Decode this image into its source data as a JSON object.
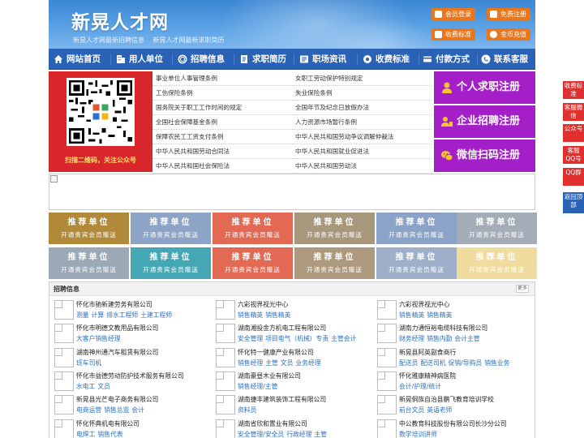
{
  "header": {
    "logo": "新晃人才网",
    "slogans": [
      "新晃人才网最新招聘信息",
      "新晃人才网最新求职简历"
    ],
    "buttons": {
      "member_login": "会员登录",
      "free_register": "免费注册",
      "fee_standard": "收费标准",
      "coin_recharge": "金币充值"
    }
  },
  "nav": [
    {
      "label": "网站首页",
      "icon": "home-icon"
    },
    {
      "label": "用人单位",
      "icon": "building-icon"
    },
    {
      "label": "招聘信息",
      "icon": "broadcast-icon"
    },
    {
      "label": "求职简历",
      "icon": "resume-icon"
    },
    {
      "label": "职场资讯",
      "icon": "news-icon"
    },
    {
      "label": "收费标准",
      "icon": "settings-icon"
    },
    {
      "label": "付款方式",
      "icon": "card-icon"
    },
    {
      "label": "联系客服",
      "icon": "phone-icon"
    }
  ],
  "qr": {
    "caption": "扫描二维码，关注公众号"
  },
  "links": {
    "left": [
      "事业单位人事管理条例",
      "工伤保险条例",
      "国务院关于职工工作时间的规定",
      "全国社会保障基金条例",
      "保障农民工工资支付条例",
      "中华人民共和国劳动合同法",
      "中华人民共和国社会保险法"
    ],
    "right": [
      "女职工劳动保护特别规定",
      "失业保险条例",
      "全国年节及纪念日放假办法",
      "人力资源市场暂行条例",
      "中华人民共和国劳动争议调解仲裁法",
      "中华人民共和国就业促进法",
      "中华人民共和国劳动法"
    ]
  },
  "register": [
    {
      "label": "个人求职注册",
      "icon": "person-icon"
    },
    {
      "label": "企业招聘注册",
      "icon": "company-icon"
    },
    {
      "label": "微信扫码注册",
      "icon": "wechat-icon"
    }
  ],
  "recommend": {
    "title": "推荐单位",
    "subtitle": "开通贵宾会员赠送",
    "colors": [
      "#b08a3a",
      "#8ea4c6",
      "#e26a55",
      "#a7987c",
      "#8ca3c8",
      "#a3acb7",
      "#9aa9b5",
      "#46a7b4",
      "#e26a55",
      "#ad9a7e",
      "#9eb0c9",
      "#f0dc9e"
    ]
  },
  "jobs": {
    "title": "招聘信息",
    "more": "更多",
    "columns": [
      [
        {
          "company": "怀化市驰新建劳务有限公司",
          "positions": [
            "测量",
            "计算",
            "排水工程师",
            "土建工程师"
          ]
        },
        {
          "company": "怀化市明德文教用品有限公司",
          "positions": [
            "大客户销售经理"
          ]
        },
        {
          "company": "湖南神州通汽车租赁有限公司",
          "positions": [
            "班车司机"
          ]
        },
        {
          "company": "怀化市益德劳动防护技术服务有限公司",
          "positions": [
            "水电工",
            "文员"
          ]
        },
        {
          "company": "新晃县光芒电子商务有限公司",
          "positions": [
            "电商运营",
            "销售总监",
            "会计"
          ]
        },
        {
          "company": "怀化怀典机电有限公司",
          "positions": [
            "电焊工",
            "销售代表"
          ]
        }
      ],
      [
        {
          "company": "六彩视界视光中心",
          "positions": [
            "销售精英",
            "销售精英"
          ]
        },
        {
          "company": "湖南湘投金方机电工程有限公司",
          "positions": [
            "安全管理",
            "项目电气（机械）专责",
            "主管会计"
          ]
        },
        {
          "company": "怀化特一健康产业有限公司",
          "positions": [
            "销售经理",
            "主管",
            "文员",
            "业务经理"
          ]
        },
        {
          "company": "湖南豪昼木业有限公司",
          "positions": [
            "销售经理/主管"
          ]
        },
        {
          "company": "湖南捷丰建筑装饰工程有限公司",
          "positions": [
            "资料员"
          ]
        },
        {
          "company": "湖南省欣和置业有限公司",
          "positions": [
            "安全管理/安全员",
            "行政经理",
            "主管"
          ]
        }
      ],
      [
        {
          "company": "六彩视界视光中心",
          "positions": [
            "销售精英",
            "销售精英"
          ]
        },
        {
          "company": "湖南力通恒裕电缆科技有限公司",
          "positions": [
            "财务经理",
            "销售内勤",
            "会计主管"
          ]
        },
        {
          "company": "新晃县阿英副食商行",
          "positions": [
            "配送员",
            "配送司机",
            "促销/导购员",
            "销售业务"
          ]
        },
        {
          "company": "怀化雅康精神病医院",
          "positions": [
            "会计/护理/统计"
          ]
        },
        {
          "company": "新晃侗族自治县鹏飞教育培训学校",
          "positions": [
            "前台文员",
            "英语老师"
          ]
        },
        {
          "company": "中公教育科技股份有限公司长沙分公司",
          "positions": [
            "数学培训讲师"
          ]
        }
      ]
    ]
  },
  "float": [
    "收费标准",
    "客服微信",
    "公众号",
    "客服QQ号",
    "QQ群",
    "返回顶部"
  ]
}
